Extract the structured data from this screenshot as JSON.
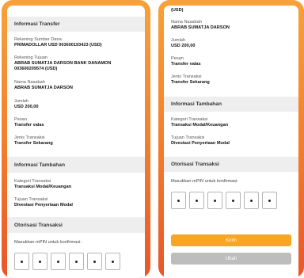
{
  "left": {
    "transfer_info_title": "Informasi Transfer",
    "fields": [
      {
        "label": "Rekening Sumber Dana",
        "value": "PRIMADOLLAR USD 003600193423 (USD)"
      },
      {
        "label": "Rekening Tujuan",
        "value": "ABRAB SUMATJA DARSON BANK DANAMON 003600209574 (USD)"
      },
      {
        "label": "Nama Nasabah",
        "value": "ABRAB SUMATJA DARSON"
      },
      {
        "label": "Jumlah",
        "value": "USD 200,00"
      },
      {
        "label": "Pesan",
        "value": "Transfer valas"
      },
      {
        "label": "Jenis Transaksi",
        "value": "Transfer Sekarang"
      }
    ],
    "additional_info_title": "Informasi Tambahan",
    "additional_fields": [
      {
        "label": "Kategori Transaksi",
        "value": "Transaksi Modal/Keuangan"
      },
      {
        "label": "Tujuan Transaksi",
        "value": "Divestasi Penyertaan Modal"
      }
    ],
    "authorization_title": "Otorisasi Transaksi",
    "pin_prompt": "Masukkan mPIN untuk konfirmasi:"
  },
  "right": {
    "top_partial_value": "(USD)",
    "fields": [
      {
        "label": "Nama Nasabah",
        "value": "ABRAB SUMATJA DARSON"
      },
      {
        "label": "Jumlah",
        "value": "USD 200,00"
      },
      {
        "label": "Pesan",
        "value": "Transfer valas"
      },
      {
        "label": "Jenis Transaksi",
        "value": "Transfer Sekarang"
      }
    ],
    "additional_info_title": "Informasi Tambahan",
    "additional_fields": [
      {
        "label": "Kategori Transaksi",
        "value": "Transaksi Modal/Keuangan"
      },
      {
        "label": "Tujuan Transaksi",
        "value": "Divestasi Penyertaan Modal"
      }
    ],
    "authorization_title": "Otorisasi Transaksi",
    "pin_prompt": "Masukkan mPIN untuk konfirmasi:",
    "send_button": "Kirim",
    "edit_button": "Ubah"
  },
  "colors": {
    "phone_gradient_top": "#f8a13a",
    "phone_gradient_bottom": "#e8552a",
    "send_button": "#f5a623",
    "edit_button": "#bdbdbd"
  }
}
